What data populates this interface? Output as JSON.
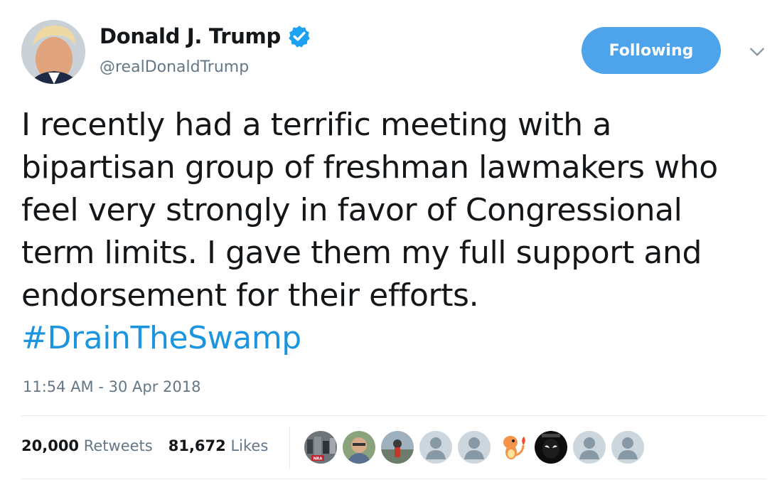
{
  "user": {
    "display_name": "Donald J. Trump",
    "handle": "@realDonaldTrump",
    "verified": true
  },
  "follow_button": {
    "label": "Following"
  },
  "tweet": {
    "lines": [
      "I recently had a terrific meeting with a",
      "bipartisan group of freshman lawmakers who",
      "feel very strongly in favor of Congressional",
      "term limits. I gave them my full support and",
      "endorsement for their efforts."
    ],
    "hashtag": "#DrainTheSwamp",
    "timestamp": "11:54 AM - 30 Apr 2018"
  },
  "stats": {
    "retweets_count": "20,000",
    "retweets_label": "Retweets",
    "likes_count": "81,672",
    "likes_label": "Likes"
  },
  "likers": [
    {
      "type": "photo-crowd",
      "badge": "NRA"
    },
    {
      "type": "photo-person"
    },
    {
      "type": "photo-outdoor"
    },
    {
      "type": "default-avatar"
    },
    {
      "type": "default-avatar"
    },
    {
      "type": "charmander-icon"
    },
    {
      "type": "photo-dark"
    },
    {
      "type": "default-avatar"
    },
    {
      "type": "default-avatar"
    }
  ],
  "colors": {
    "accent": "#4ea4ea",
    "link": "#1b95e0",
    "muted": "#657786",
    "text": "#14171a",
    "divider": "#e6ecf0",
    "verified": "#1da1f2"
  }
}
